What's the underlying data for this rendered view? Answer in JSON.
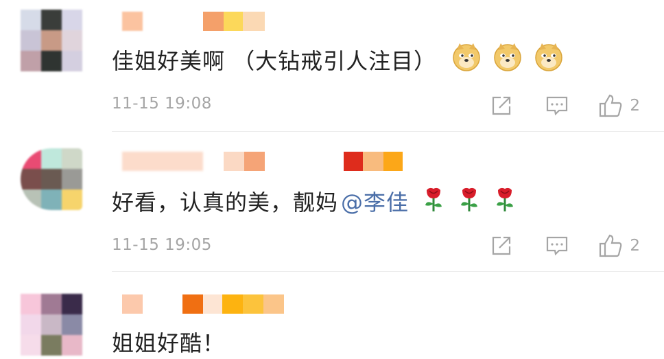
{
  "comments": [
    {
      "text": "佳姐好美啊 （大钻戒引人注目）",
      "mention": "",
      "emoji": [
        "doge-emoji",
        "doge-emoji",
        "doge-emoji"
      ],
      "time": "11-15 19:08",
      "likes": "2"
    },
    {
      "text": "好看，认真的美，靓妈",
      "mention": "@李佳",
      "emoji": [
        "rose-emoji",
        "rose-emoji",
        "rose-emoji"
      ],
      "time": "11-15 19:05",
      "likes": "2"
    },
    {
      "text": "姐姐好酷！",
      "mention": "",
      "emoji": [],
      "time": "",
      "likes": ""
    }
  ],
  "colors": {
    "text": "#222222",
    "meta": "#a5a5a5",
    "mention": "#4a6ea8",
    "divider": "#ececec"
  },
  "icons": [
    "share-icon",
    "comment-icon",
    "like-icon"
  ]
}
